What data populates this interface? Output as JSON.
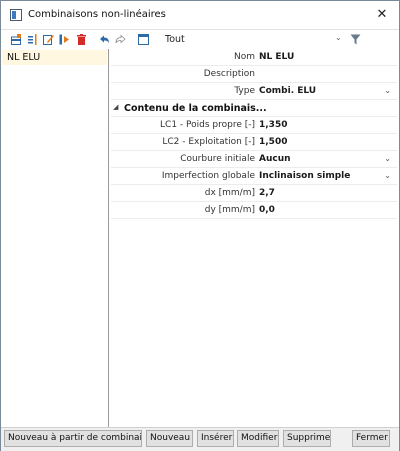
{
  "window": {
    "title": "Combinaisons non-linéaires"
  },
  "toolbar": {
    "filter_value": "Tout"
  },
  "list": {
    "items": [
      "NL ELU"
    ]
  },
  "properties": {
    "nom": {
      "label": "Nom",
      "value": "NL ELU"
    },
    "description": {
      "label": "Description",
      "value": ""
    },
    "type": {
      "label": "Type",
      "value": "Combi. ELU"
    },
    "section": "Contenu de la combinais...",
    "lc1": {
      "label": "LC1 - Poids propre [-]",
      "value": "1,350"
    },
    "lc2": {
      "label": "LC2 - Exploitation [-]",
      "value": "1,500"
    },
    "courbure": {
      "label": "Courbure initiale",
      "value": "Aucun"
    },
    "imperfection": {
      "label": "Imperfection globale",
      "value": "Inclinaison simple"
    },
    "dx": {
      "label": "dx [mm/m]",
      "value": "2,7"
    },
    "dy": {
      "label": "dy [mm/m]",
      "value": "0,0"
    }
  },
  "buttons": {
    "nouveau_partir": "Nouveau à partir de combinais...",
    "nouveau": "Nouveau",
    "inserer": "Insérer",
    "modifier": "Modifier",
    "supprimer": "Supprimer",
    "fermer": "Fermer"
  }
}
